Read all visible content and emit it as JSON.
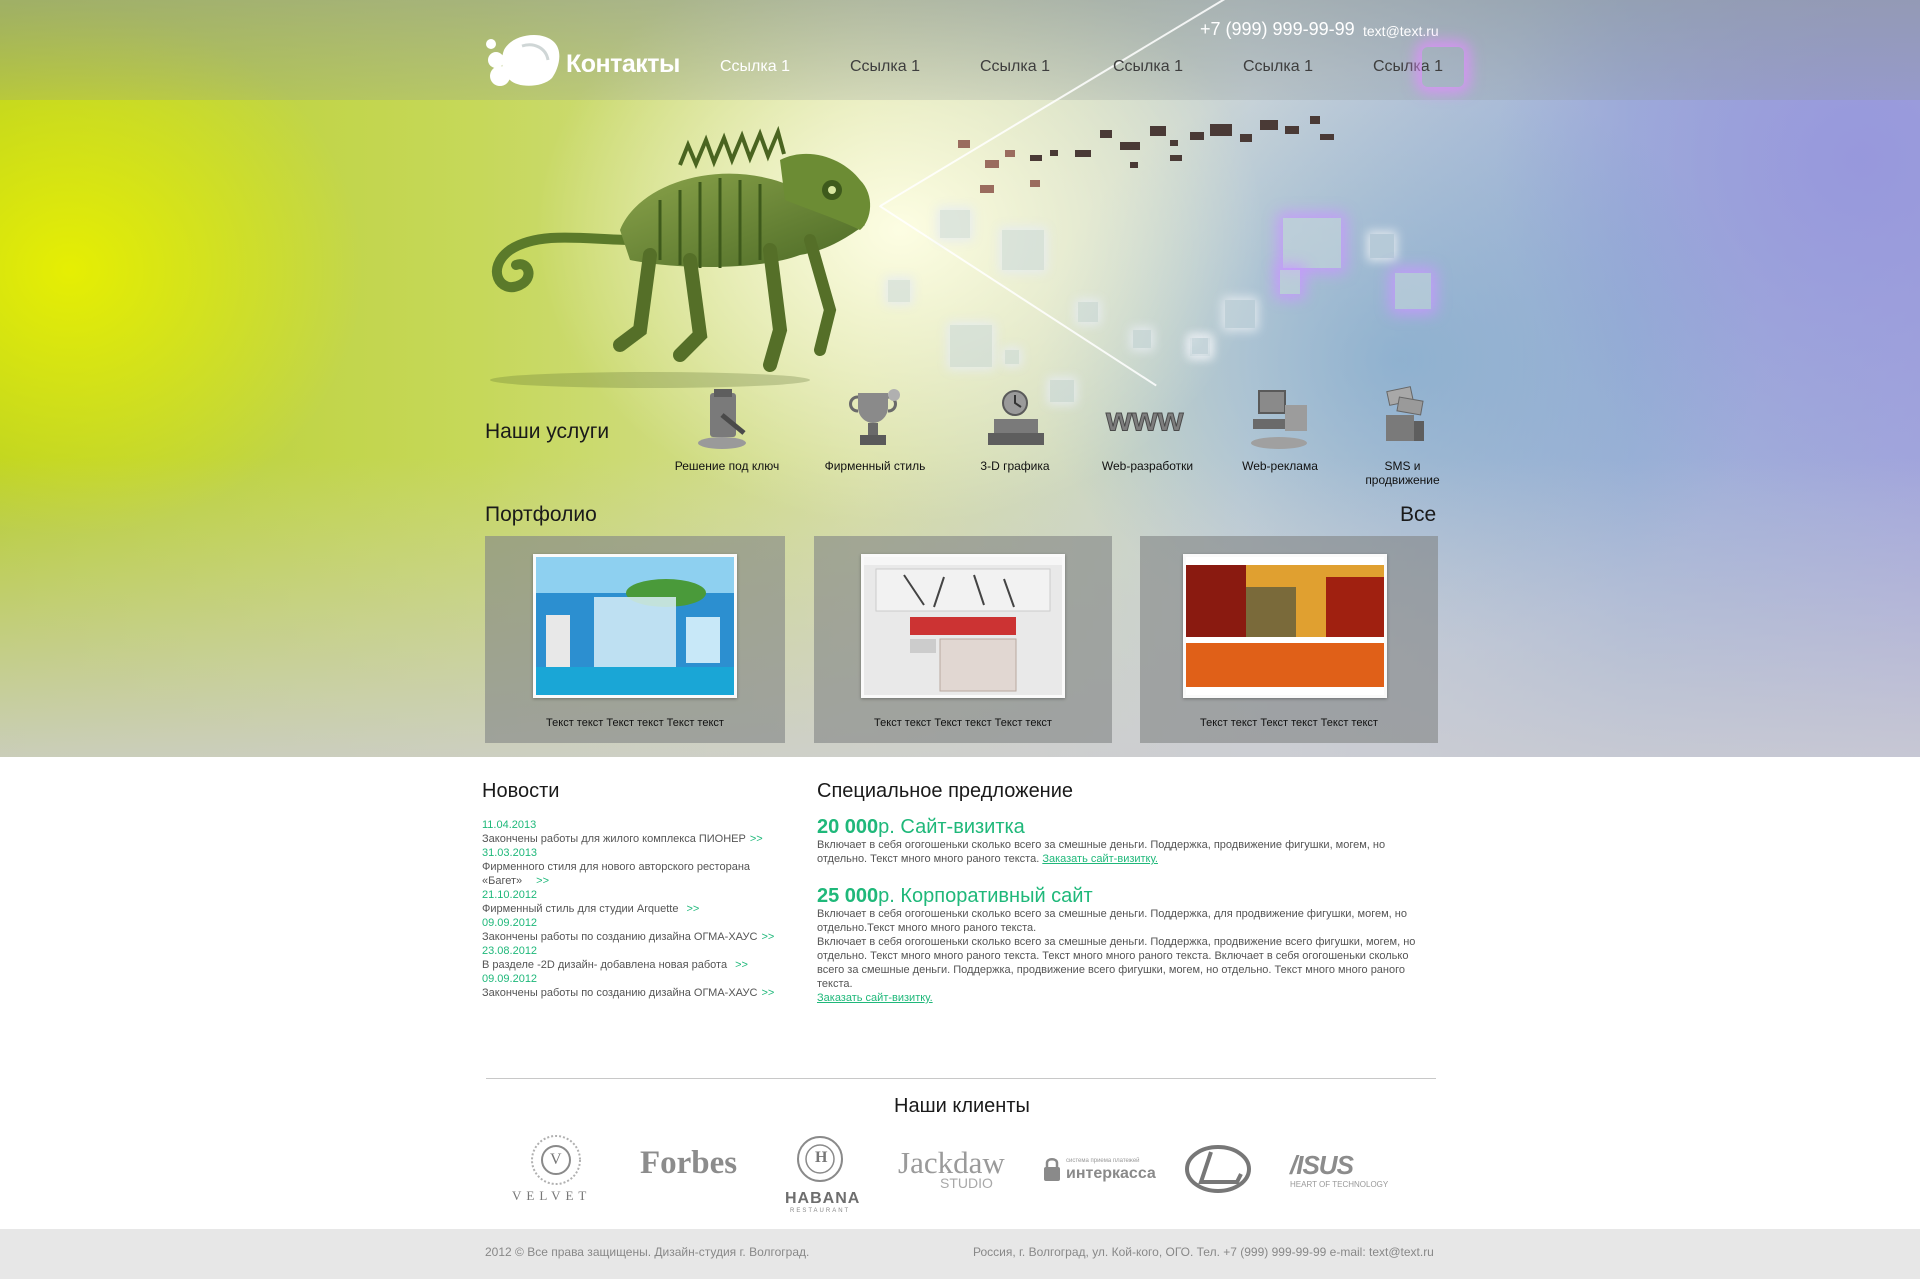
{
  "header": {
    "logo_title": "Контакты",
    "phone": "+7 (999) 999-99-99",
    "email": "text@text.ru",
    "nav": [
      "Ссылка 1",
      "Ссылка 1",
      "Ссылка 1",
      "Ссылка 1",
      "Ссылка 1",
      "Ссылка 1"
    ]
  },
  "services": {
    "title": "Наши услуги",
    "items": [
      {
        "label": "Решение под ключ",
        "icon": "lock-key-icon"
      },
      {
        "label": "Фирменный стиль",
        "icon": "trophy-cup-icon"
      },
      {
        "label": "3-D графика",
        "icon": "alarm-clock-icon"
      },
      {
        "label": "Web-разработки",
        "icon": "www-letters-icon"
      },
      {
        "label": "Web-реклама",
        "icon": "computer-desk-icon"
      },
      {
        "label": "SMS и продвижение",
        "icon": "envelopes-icon"
      }
    ]
  },
  "portfolio": {
    "title": "Портфолио",
    "all_link": "Все",
    "items": [
      {
        "caption": "Текст текст Текст текст Текст текст"
      },
      {
        "caption": "Текст текст Текст текст Текст текст"
      },
      {
        "caption": "Текст текст Текст текст Текст текст"
      }
    ]
  },
  "news": {
    "title": "Новости",
    "more_label": ">>",
    "items": [
      {
        "date": "11.04.2013",
        "text": "Закончены работы для жилого комплекса ПИОНЕР"
      },
      {
        "date": "31.03.2013",
        "text": "Фирменного стиля для нового авторского ресторана «Багет»"
      },
      {
        "date": "21.10.2012",
        "text": "Фирменный стиль для студии Arquette"
      },
      {
        "date": "09.09.2012",
        "text": "Закончены работы по созданию дизайна ОГМА-ХАУС"
      },
      {
        "date": "23.08.2012",
        "text": "В разделе -2D дизайн- добавлена новая работа"
      },
      {
        "date": "09.09.2012",
        "text": "Закончены работы по созданию дизайна ОГМА-ХАУС"
      }
    ]
  },
  "offer": {
    "title": "Специальное предложение",
    "items": [
      {
        "price": "20 000",
        "price_suffix": "р. Сайт-визитка",
        "text": "Включает в себя огогошеньки сколько всего за смешные деньги. Поддержка, продвижение фигушки, могем, но отдельно. Текст много много раного текста.",
        "link": "Заказать сайт-визитку."
      },
      {
        "price": "25 000",
        "price_suffix": "р. Корпоративный сайт",
        "text": "Включает в себя огогошеньки сколько всего за смешные деньги. Поддержка, для продвижение фигушки, могем, но отдельно.Текст много много раного текста.",
        "text2": "Включает в себя огогошеньки сколько всего за смешные деньги. Поддержка, продвижение всего фигушки, могем, но отдельно. Текст много много раного текста. Текст много много раного текста. Включает в себя огогошеньки сколько всего за смешные деньги. Поддержка, продвижение всего фигушки, могем, но отдельно. Текст много много раного текста.",
        "link": "Заказать сайт-визитку."
      }
    ]
  },
  "clients": {
    "title": "Наши клиенты",
    "velvet": "VELVET",
    "velvet_mark": "V",
    "forbes": "Forbes",
    "habana": "HABANA",
    "habana_sub": "RESTAURANT",
    "habana_mark": "H",
    "jackdaw": "Jackdaw",
    "jackdaw_sub": "STUDIO",
    "interkassa_small": "система приема платежей",
    "interkassa": "интеркасса",
    "asus": "/ISUS",
    "asus_sub": "HEART OF TECHNOLOGY"
  },
  "footer": {
    "left": "2012 © Все права защищены. Дизайн-студия  г. Волгоград.",
    "right": "Россия, г. Волгоград, ул. Кой-кого, ОГО. Тел. +7 (999) 999-99-99 e-mail: text@text.ru"
  }
}
